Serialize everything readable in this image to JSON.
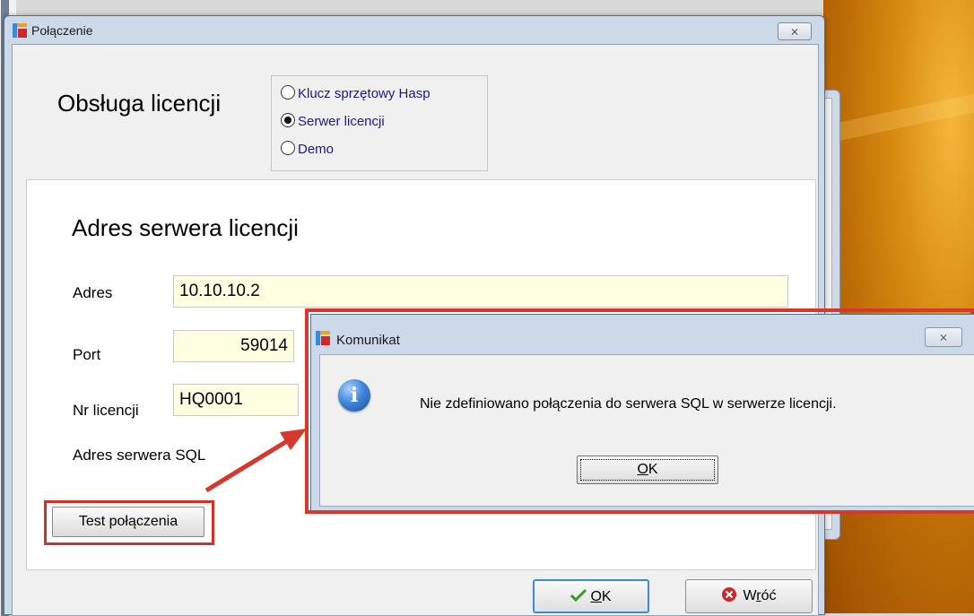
{
  "window": {
    "title": "Połączenie",
    "close_glyph": "⨯"
  },
  "license": {
    "heading": "Obsługa licencji",
    "options": [
      {
        "label": "Klucz sprzętowy Hasp",
        "checked": false
      },
      {
        "label": "Serwer licencji",
        "checked": true
      },
      {
        "label": "Demo",
        "checked": false
      }
    ]
  },
  "server": {
    "heading": "Adres serwera licencji",
    "address_label": "Adres",
    "address_value": "10.10.10.2",
    "port_label": "Port",
    "port_value": "59014",
    "license_no_label": "Nr  licencji",
    "license_no_value": "HQ0001",
    "sql_label": "Adres serwera SQL",
    "test_button": "Test połączenia"
  },
  "footer": {
    "ok_prefix": "",
    "ok_underlined": "O",
    "ok_suffix": "K",
    "back_prefix": "W",
    "back_underlined": "r",
    "back_suffix": "óć"
  },
  "message": {
    "title": "Komunikat",
    "close_glyph": "⨯",
    "text": "Nie zdefiniowano połączenia do serwera SQL w serwerze licencji.",
    "ok_underlined": "O",
    "ok_suffix": "K"
  },
  "colors": {
    "field_bg": "#ffffe1",
    "highlight_red": "#d6382c",
    "focus_blue": "#3a8bd8",
    "radio_text": "#1a1a8a"
  },
  "icons": {
    "app": "app-logo-icon",
    "info": "info-icon",
    "ok_check": "checkmark-icon",
    "back": "cancel-circle-icon",
    "arrow": "annotation-arrow"
  }
}
